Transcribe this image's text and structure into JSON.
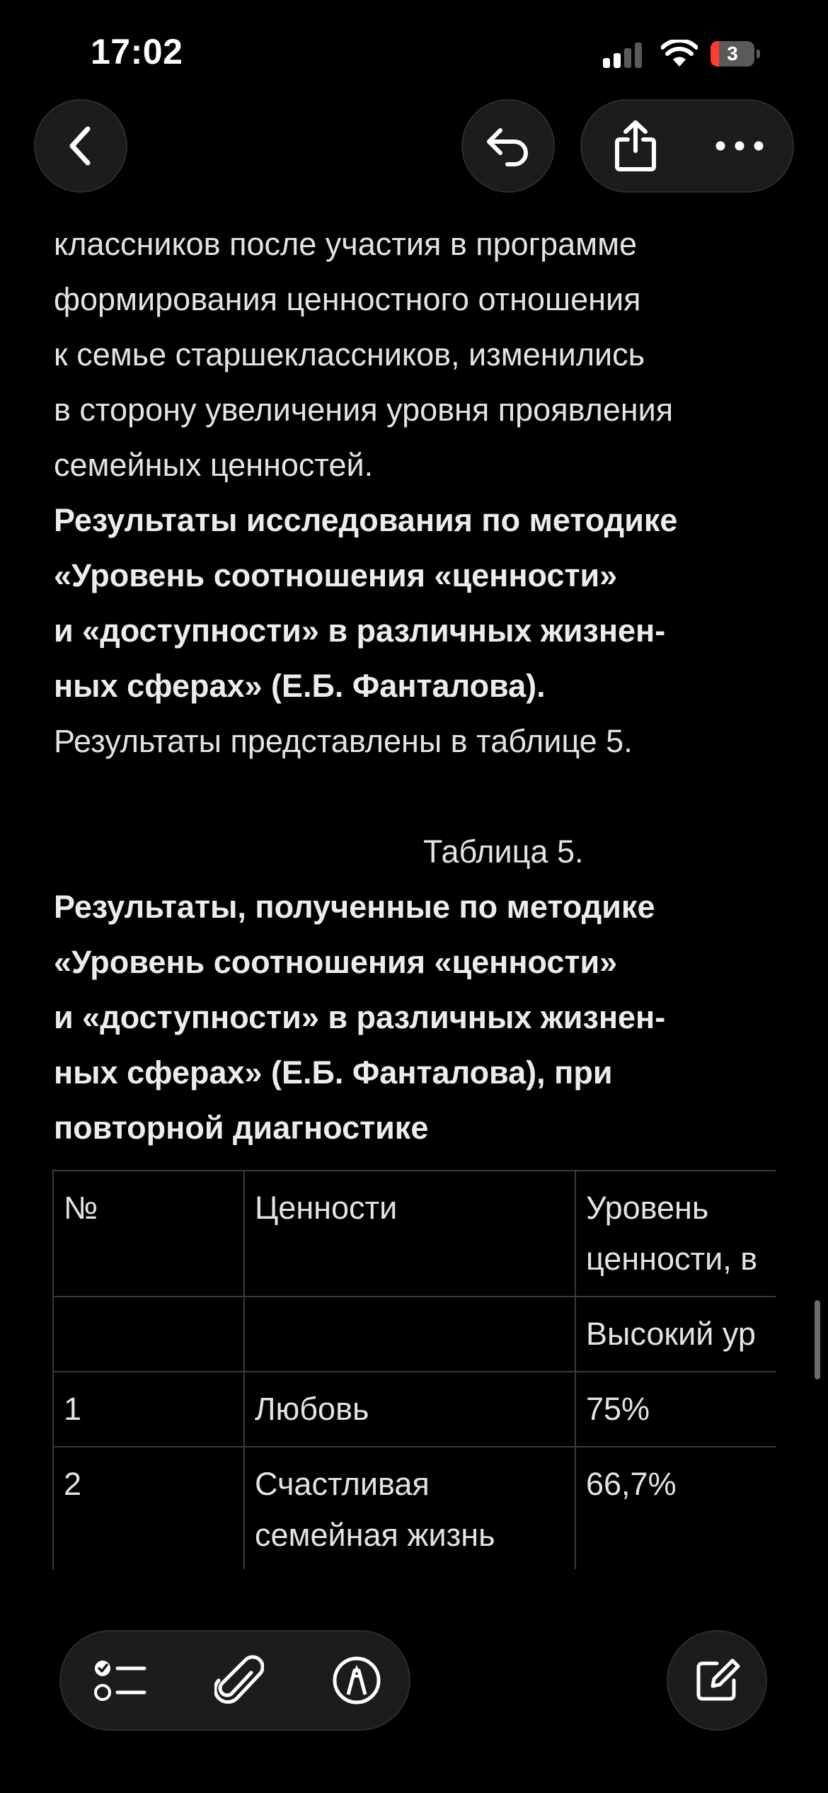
{
  "status_bar": {
    "time": "17:02",
    "battery_level": "3",
    "battery_fraction": 0.03,
    "signal_bars_active": 2,
    "signal_bars_total": 4,
    "battery_color": "#ff3b30"
  },
  "nav": {
    "back_icon": "chevron-left-icon",
    "undo_icon": "undo-icon",
    "share_icon": "share-icon",
    "more_icon": "ellipsis-icon"
  },
  "note": {
    "intro_lines": [
      "классников после участия в программе",
      "формирования ценностного отношения",
      "к семье старшеклассников, изменились",
      "в сторону увеличения уровня проявления",
      "семейных ценностей."
    ],
    "heading_lines": [
      "Результаты исследования по методике",
      "«Уровень соотношения «ценности»",
      "и «доступности» в различных жизнен-",
      "ных сферах» (Е.Б. Фанталова)."
    ],
    "results_line": "Результаты представлены в таблице 5.",
    "table_caption": "Таблица 5.",
    "table_title_lines": [
      "Результаты, полученные по методике",
      "«Уровень соотношения «ценности»",
      "и «доступности» в различных жизнен-",
      "ных сферах» (Е.Б. Фанталова), при",
      "повторной диагностике"
    ]
  },
  "table": {
    "header": {
      "num": "№",
      "values": "Ценности",
      "level_line1": "Уровень",
      "level_line2": "ценности, в"
    },
    "subheader": {
      "num": "",
      "values": "",
      "level": "Высокий ур"
    },
    "rows": [
      {
        "num": "1",
        "value": "Любовь",
        "level": "75%"
      },
      {
        "num": "2",
        "value": "Счастливая семейная жизнь",
        "level": "66,7%"
      }
    ]
  },
  "toolbar": {
    "checklist_icon": "checklist-icon",
    "attach_icon": "paperclip-icon",
    "markup_icon": "markup-pen-icon",
    "compose_icon": "compose-icon"
  }
}
